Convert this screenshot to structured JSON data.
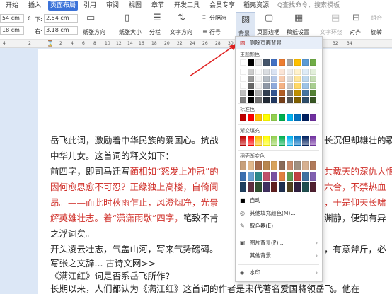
{
  "tabs": [
    "开始",
    "插入",
    "页面布局",
    "引用",
    "审阅",
    "视图",
    "章节",
    "开发工具",
    "会员专享",
    "稻壳资源"
  ],
  "search": {
    "label": "Q查找命令、搜索模板"
  },
  "right_tabs": [
    "组合",
    "旋转"
  ],
  "toolbar": {
    "margin_top_value": "54 cm",
    "margin_bottom_value": "18 cm",
    "top_label": "下:",
    "right_label": "右:",
    "right_value": "2.54 cm",
    "left_value": "3.18 cm",
    "orientation": "纸张方向",
    "size": "纸张大小",
    "columns": "分栏",
    "text_dir": "文字方向",
    "line_num": "行号",
    "separator": "分隔符",
    "background": "背景",
    "page_border": "页面边框",
    "grid": "稿纸设置",
    "text_wrap": "文字环绕",
    "align": "对齐",
    "combine": "组合",
    "rotate": "旋转"
  },
  "ruler": [
    "4",
    "2",
    "2",
    "4",
    "6",
    "8",
    "10",
    "12",
    "14",
    "16",
    "18",
    "20",
    "22",
    "24",
    "26",
    "28",
    "30",
    "32",
    "34"
  ],
  "menu": {
    "remove_bg": "删除页面背景",
    "theme_colors": "主题颜色",
    "standard": "标准色",
    "gradient_fill": "渐变填充",
    "rice_gradient": "稻壳渐变色",
    "auto": "自动",
    "other_fill": "其他填充颜色(M)...",
    "picker": "取色器(E)",
    "picture_bg": "图片背景(P)...",
    "other_bg": "其他背景",
    "watermark": "水印"
  },
  "theme_top": [
    "#ffffff",
    "#000000",
    "#e7e6e6",
    "#44546a",
    "#4472c4",
    "#ed7d31",
    "#a5a5a5",
    "#ffc000",
    "#5b9bd5",
    "#70ad47"
  ],
  "standard_colors": [
    "#c00000",
    "#ff0000",
    "#ffc000",
    "#ffff00",
    "#92d050",
    "#00b050",
    "#00b0f0",
    "#0070c0",
    "#002060",
    "#7030a0"
  ],
  "doc": {
    "line1": "岳飞此词，激励着中华民族的爱国心。抗战",
    "line1_tail": "长沉但却雄壮的歌",
    "line2": "中华儿女。这首词的释义如下：",
    "line3_a": "前四字，即司马迁写",
    "line3_b": "蔺相如“怒发上冲冠”的",
    "line3_tail": "共戴天的深仇大恨。",
    "line4": "因何愈思愈不可忍？正缘独上高楼，自倚阑",
    "line4_tail": "六合，不禁热血",
    "line5": "昂。——而此时秋雨乍止，风澄烟净，光景",
    "line5_tail": "，于是仰天长啸",
    "line6": "解英雄壮志。着“潇潇雨歇”四字，",
    "line6_b": "笔致不肯",
    "line6_tail": "渊静，便知有异",
    "line7": "之浮词矣。",
    "line8": "开头凌云壮志，气盖山河，写来气势磅礴。",
    "line8_tail": "，有意斧斤，必",
    "line9": "写张之文辞... 古诗文网>>",
    "line10": "《满江红》词是否系岳飞所作？",
    "line11": "长期以来，人们都认为《满江红》这首词的作者是宋代著名爱国将领岳飞。他在"
  }
}
